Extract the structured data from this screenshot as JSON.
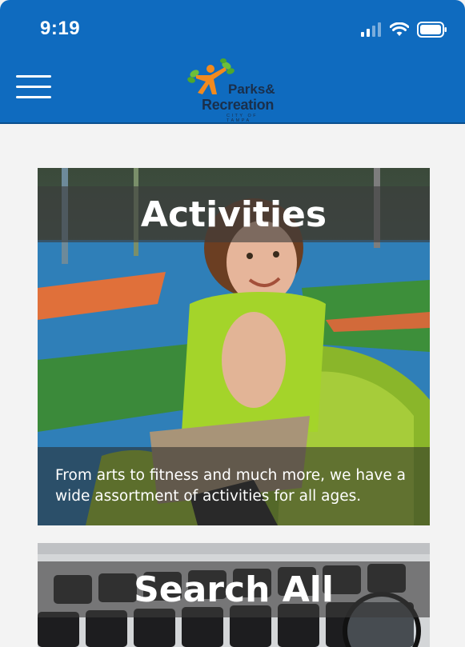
{
  "status_bar": {
    "time": "9:19",
    "icons": [
      "signal-icon",
      "wifi-icon",
      "battery-icon"
    ]
  },
  "header": {
    "menu_icon": "hamburger-menu-icon",
    "logo": {
      "line1": "Parks&",
      "line2": "Recreation",
      "line3": "CITY OF TAMPA"
    },
    "background_color": "#0f6bbf"
  },
  "cards": [
    {
      "title": "Activities",
      "description": "From arts to fitness and much more, we have a wide assortment of activities for all ages."
    },
    {
      "title": "Search All"
    }
  ]
}
